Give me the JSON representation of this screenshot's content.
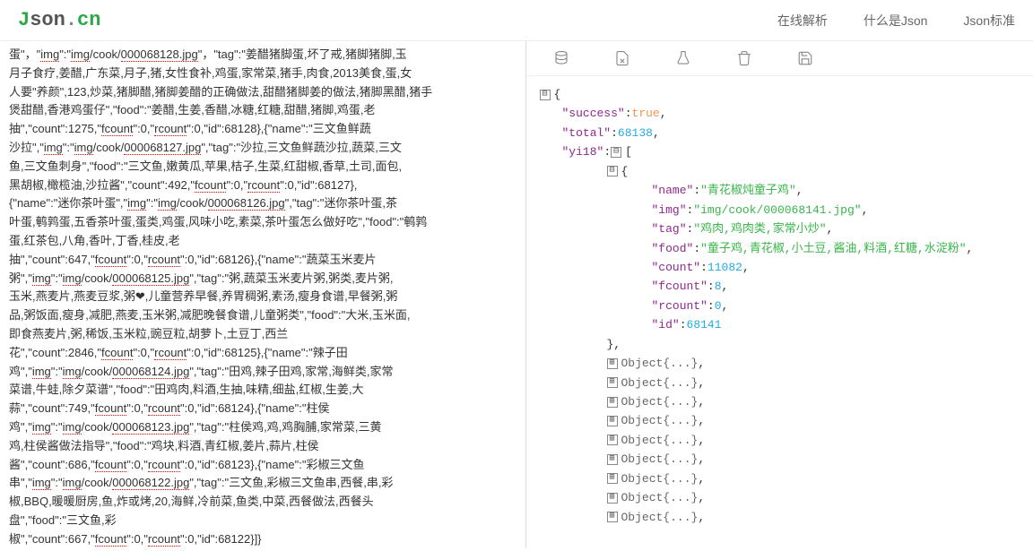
{
  "logo": {
    "j": "J",
    "son": "son",
    "dot": ".",
    "cn": "cn"
  },
  "nav": {
    "parse": "在线解析",
    "what": "什么是Json",
    "std": "Json标准"
  },
  "left": {
    "l1a": "蛋\"，\"",
    "l1b": "img",
    "l1c": "\":\"",
    "l1d": "img",
    "l1e": "/cook/",
    "l1f": "000068128.jpg",
    "l1g": "\"，\"tag\":\"姜醋猪脚蛋,坏了戒,猪脚猪脚,玉",
    "l2": "月子食疗,姜醋,广东菜,月子,猪,女性食补,鸡蛋,家常菜,猪手,肉食,2013美食,蛋,女",
    "l3": "人要\"养颜\",123,炒菜,猪脚醋,猪脚姜醋的正确做法,甜醋猪脚姜的做法,猪脚黑醋,猪手",
    "l4": "煲甜醋,香港鸡蛋仔\",\"food\":\"姜醋,生姜,香醋,冰糖,红糖,甜醋,猪脚,鸡蛋,老",
    "l5a": "抽\",\"count\":1275,\"",
    "l5b": "fcount",
    "l5c": "\":0,\"",
    "l5d": "rcount",
    "l5e": "\":0,\"id\":68128},{\"name\":\"三文鱼鲜蔬",
    "l6a": "沙拉\",\"",
    "l6b": "img",
    "l6c": "\":\"",
    "l6d": "img",
    "l6e": "/cook/",
    "l6f": "000068127.jpg",
    "l6g": "\",\"tag\":\"沙拉,三文鱼鲜蔬沙拉,蔬菜,三文",
    "l7": "鱼,三文鱼刺身\",\"food\":\"三文鱼,嫩黄瓜,苹果,桔子,生菜,红甜椒,香草,土司,面包,",
    "l8a": "黑胡椒,橄榄油,沙拉酱\",\"count\":492,\"",
    "l8b": "fcount",
    "l8c": "\":0,\"",
    "l8d": "rcount",
    "l8e": "\":0,\"id\":68127},",
    "l9a": "{\"name\":\"迷你茶叶蛋\",\"",
    "l9b": "img",
    "l9c": "\":\"",
    "l9d": "img",
    "l9e": "/cook/",
    "l9f": "000068126.jpg",
    "l9g": "\",\"tag\":\"迷你茶叶蛋,茶",
    "l10": "叶蛋,鹌鹑蛋,五香茶叶蛋,蛋类,鸡蛋,风味小吃,素菜,茶叶蛋怎么做好吃\",\"food\":\"鹌鹑",
    "l11": "蛋,红茶包,八角,香叶,丁香,桂皮,老",
    "l12a": "抽\",\"count\":647,\"",
    "l12b": "fcount",
    "l12c": "\":0,\"",
    "l12d": "rcount",
    "l12e": "\":0,\"id\":68126},{\"name\":\"蔬菜玉米麦片",
    "l13a": "粥\",\"",
    "l13b": "img",
    "l13c": "\":\"",
    "l13d": "img",
    "l13e": "/cook/",
    "l13f": "000068125.jpg",
    "l13g": "\",\"tag\":\"粥,蔬菜玉米麦片粥,粥类,麦片粥,",
    "l14": "玉米,燕麦片,燕麦豆浆,粥❤,儿童营养早餐,养胃稠粥,素汤,瘦身食谱,早餐粥,粥",
    "l15": "品,粥饭面,瘦身,减肥,燕麦,玉米粥,减肥晚餐食谱,儿童粥类\",\"food\":\"大米,玉米面,",
    "l16": "即食燕麦片,粥,稀饭,玉米粒,豌豆粒,胡萝卜,土豆丁,西兰",
    "l17a": "花\",\"count\":2846,\"",
    "l17b": "fcount",
    "l17c": "\":0,\"",
    "l17d": "rcount",
    "l17e": "\":0,\"id\":68125},{\"name\":\"辣子田",
    "l18a": "鸡\",\"",
    "l18b": "img",
    "l18c": "\":\"",
    "l18d": "img",
    "l18e": "/cook/",
    "l18f": "000068124.jpg",
    "l18g": "\",\"tag\":\"田鸡,辣子田鸡,家常,海鲜类,家常",
    "l19": "菜谱,牛蛙,除夕菜谱\",\"food\":\"田鸡肉,料酒,生抽,味精,细盐,红椒,生姜,大",
    "l20a": "蒜\",\"count\":749,\"",
    "l20b": "fcount",
    "l20c": "\":0,\"",
    "l20d": "rcount",
    "l20e": "\":0,\"id\":68124},{\"name\":\"柱侯",
    "l21a": "鸡\",\"",
    "l21b": "img",
    "l21c": "\":\"",
    "l21d": "img",
    "l21e": "/cook/",
    "l21f": "000068123.jpg",
    "l21g": "\",\"tag\":\"柱侯鸡,鸡,鸡胸脯,家常菜,三黄",
    "l22": "鸡,柱侯酱做法指导\",\"food\":\"鸡块,料酒,青红椒,姜片,蒜片,柱侯",
    "l23a": "酱\",\"count\":686,\"",
    "l23b": "fcount",
    "l23c": "\":0,\"",
    "l23d": "rcount",
    "l23e": "\":0,\"id\":68123},{\"name\":\"彩椒三文鱼",
    "l24a": "串\",\"",
    "l24b": "img",
    "l24c": "\":\"",
    "l24d": "img",
    "l24e": "/cook/",
    "l24f": "000068122.jpg",
    "l24g": "\",\"tag\":\"三文鱼,彩椒三文鱼串,西餐,串,彩",
    "l25": "椒,BBQ,暖暖厨房,鱼,炸或烤,20,海鲜,冷前菜,鱼类,中菜,西餐做法,西餐头",
    "l26": "盘\",\"food\":\"三文鱼,彩",
    "l27a": "椒\",\"count\":667,\"",
    "l27b": "fcount",
    "l27c": "\":0,\"",
    "l27d": "rcount",
    "l27e": "\":0,\"id\":68122}]}"
  },
  "tree": {
    "success_k": "\"success\"",
    "success_v": "true",
    "total_k": "\"total\"",
    "total_v": "68138",
    "yi18_k": "\"yi18\"",
    "name_k": "\"name\"",
    "name_v": "\"青花椒炖童子鸡\"",
    "img_k": "\"img\"",
    "img_v": "\"img/cook/000068141.jpg\"",
    "tag_k": "\"tag\"",
    "tag_v": "\"鸡肉,鸡肉类,家常小炒\"",
    "food_k": "\"food\"",
    "food_v": "\"童子鸡,青花椒,小土豆,酱油,料酒,红糖,水淀粉\"",
    "count_k": "\"count\"",
    "count_v": "11082",
    "fcount_k": "\"fcount\"",
    "fcount_v": "8",
    "rcount_k": "\"rcount\"",
    "rcount_v": "0",
    "id_k": "\"id\"",
    "id_v": "68141",
    "obj": "Object{...}",
    "close": "},",
    "minus": "⊟",
    "plus": "⊞",
    "ob": "{",
    "cb": "}",
    "obr": "[",
    "comma": ","
  }
}
